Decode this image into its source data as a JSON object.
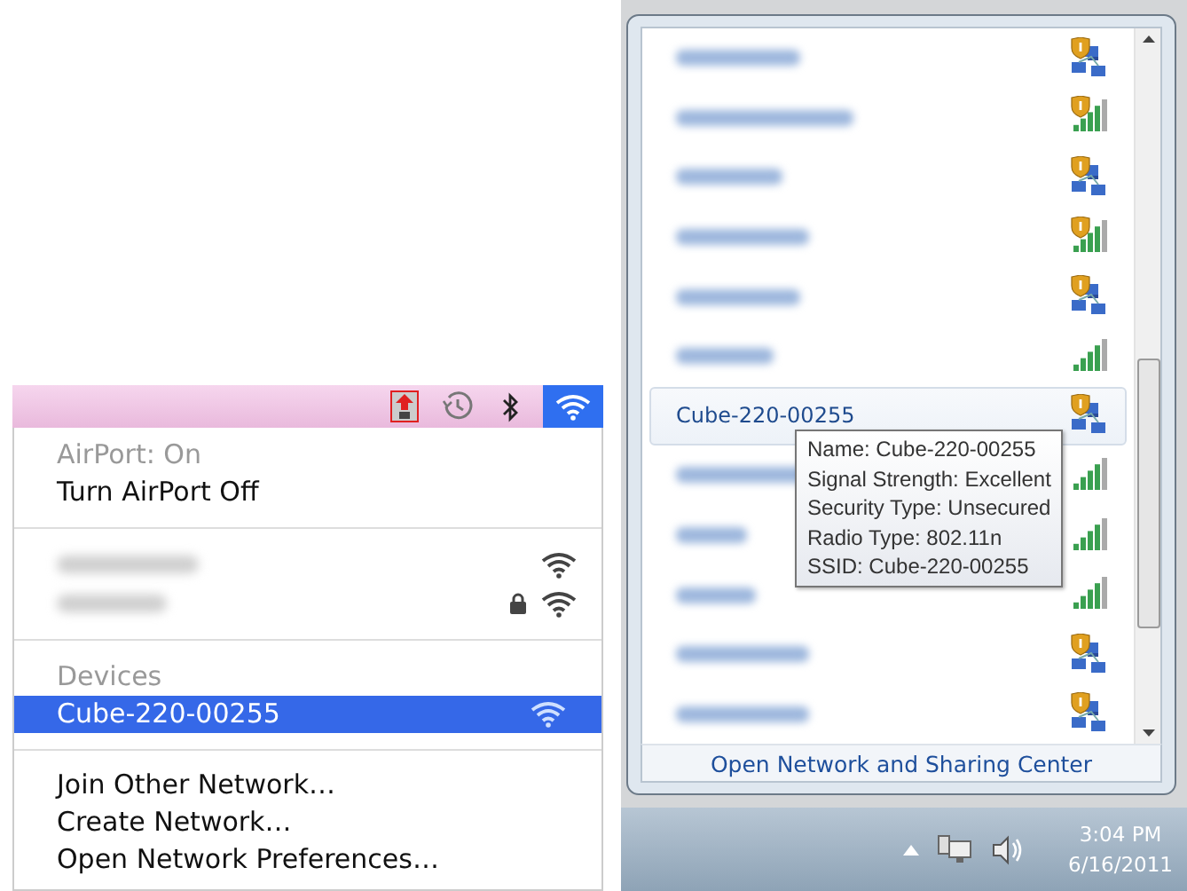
{
  "mac_menu": {
    "menubar_icons": [
      {
        "kind": "upload",
        "selected": false
      },
      {
        "kind": "clock",
        "selected": false
      },
      {
        "kind": "bluetooth",
        "selected": false
      },
      {
        "kind": "wifi",
        "selected": true
      }
    ],
    "status": "AirPort: On",
    "toggle": "Turn AirPort Off",
    "networks": [
      {
        "locked": false
      },
      {
        "locked": true
      }
    ],
    "devices_header": "Devices",
    "devices": [
      {
        "name": "Cube-220-00255",
        "selected": true
      }
    ],
    "actions": [
      "Join Other Network…",
      "Create Network…",
      "Open Network Preferences…"
    ]
  },
  "windows_panel": {
    "networks": [
      {
        "kind": "adhoc",
        "shield": true,
        "selected": false
      },
      {
        "kind": "signal",
        "shield": true,
        "selected": false
      },
      {
        "kind": "adhoc",
        "shield": true,
        "selected": false
      },
      {
        "kind": "signal",
        "shield": true,
        "selected": false
      },
      {
        "kind": "adhoc",
        "shield": true,
        "selected": false
      },
      {
        "kind": "signal",
        "shield": false,
        "selected": false
      },
      {
        "kind": "adhoc",
        "shield": true,
        "selected": true,
        "name": "Cube-220-00255"
      },
      {
        "kind": "signal",
        "selected": false
      },
      {
        "kind": "signal",
        "selected": false
      },
      {
        "kind": "signal",
        "shield": false,
        "selected": false
      },
      {
        "kind": "adhoc",
        "shield": true,
        "selected": false
      },
      {
        "kind": "adhoc",
        "shield": true,
        "selected": false
      }
    ],
    "tooltip": [
      "Name: Cube-220-00255",
      "Signal Strength: Excellent",
      "Security Type: Unsecured",
      "Radio Type: 802.11n",
      "SSID: Cube-220-00255"
    ],
    "footer_link": "Open Network and Sharing Center"
  },
  "taskbar": {
    "time": "3:04 PM",
    "date": "6/16/2011"
  }
}
